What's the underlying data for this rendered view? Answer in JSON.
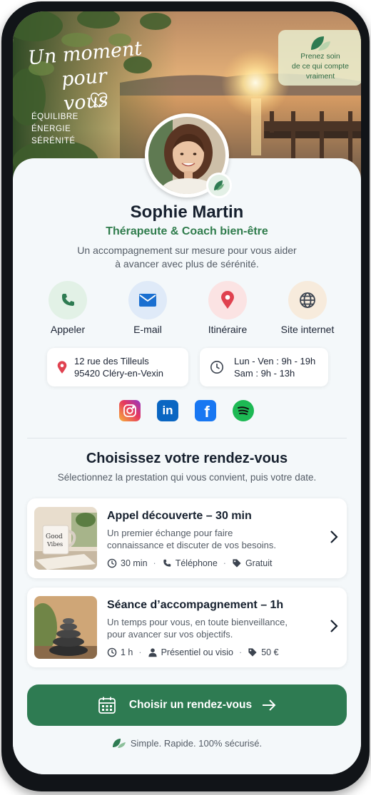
{
  "hero": {
    "title_line1": "Un moment",
    "title_line2": "pour vous",
    "words": [
      "ÉQUILIBRE",
      "ÉNERGIE",
      "SÉRÉNITÉ"
    ],
    "badge": [
      "Prenez soin",
      "de ce qui compte",
      "vraiment"
    ]
  },
  "profile": {
    "name": "Sophie Martin",
    "role": "Thérapeute & Coach bien-être",
    "description_line1": "Un accompagnement sur mesure pour vous aider",
    "description_line2": "à avancer avec plus de sérénité."
  },
  "actions": [
    {
      "label": "Appeler",
      "icon": "phone-icon",
      "color": "#2e7b52",
      "bg": "#e2f1e6"
    },
    {
      "label": "E-mail",
      "icon": "mail-icon",
      "color": "#1a6fd0",
      "bg": "#dfeaf8"
    },
    {
      "label": "Itinéraire",
      "icon": "map-pin-icon",
      "color": "#e04250",
      "bg": "#fbe3e3"
    },
    {
      "label": "Site internet",
      "icon": "globe-icon",
      "color": "#3c4450",
      "bg": "#f7ebdc"
    }
  ],
  "address": {
    "line1": "12 rue des Tilleuls",
    "line2": "95420 Cléry-en-Vexin"
  },
  "hours": {
    "line1": "Lun - Ven : 9h - 19h",
    "line2": "Sam : 9h - 13h"
  },
  "socials": [
    "instagram-icon",
    "linkedin-icon",
    "facebook-icon",
    "spotify-icon"
  ],
  "booking": {
    "title": "Choisissez votre rendez-vous",
    "subtitle": "Sélectionnez la prestation qui vous convient, puis votre date."
  },
  "services": [
    {
      "title": "Appel découverte – 30 min",
      "desc_line1": "Un premier échange pour faire",
      "desc_line2": "connaissance et discuter de vos besoins.",
      "duration": "30 min",
      "mode": "Téléphone",
      "price": "Gratuit",
      "mug_text": "Good Vibes"
    },
    {
      "title": "Séance d’accompagnement – 1h",
      "desc_line1": "Un temps pour vous, en toute bienveillance,",
      "desc_line2": "pour avancer sur vos objectifs.",
      "duration": "1 h",
      "mode": "Présentiel ou visio",
      "price": "50 €"
    }
  ],
  "cta": {
    "label": "Choisir un rendez-vous"
  },
  "footer": {
    "text": "Simple. Rapide. 100% sécurisé."
  },
  "colors": {
    "accent": "#2e7b52",
    "text": "#16202e",
    "muted": "#545c66"
  }
}
